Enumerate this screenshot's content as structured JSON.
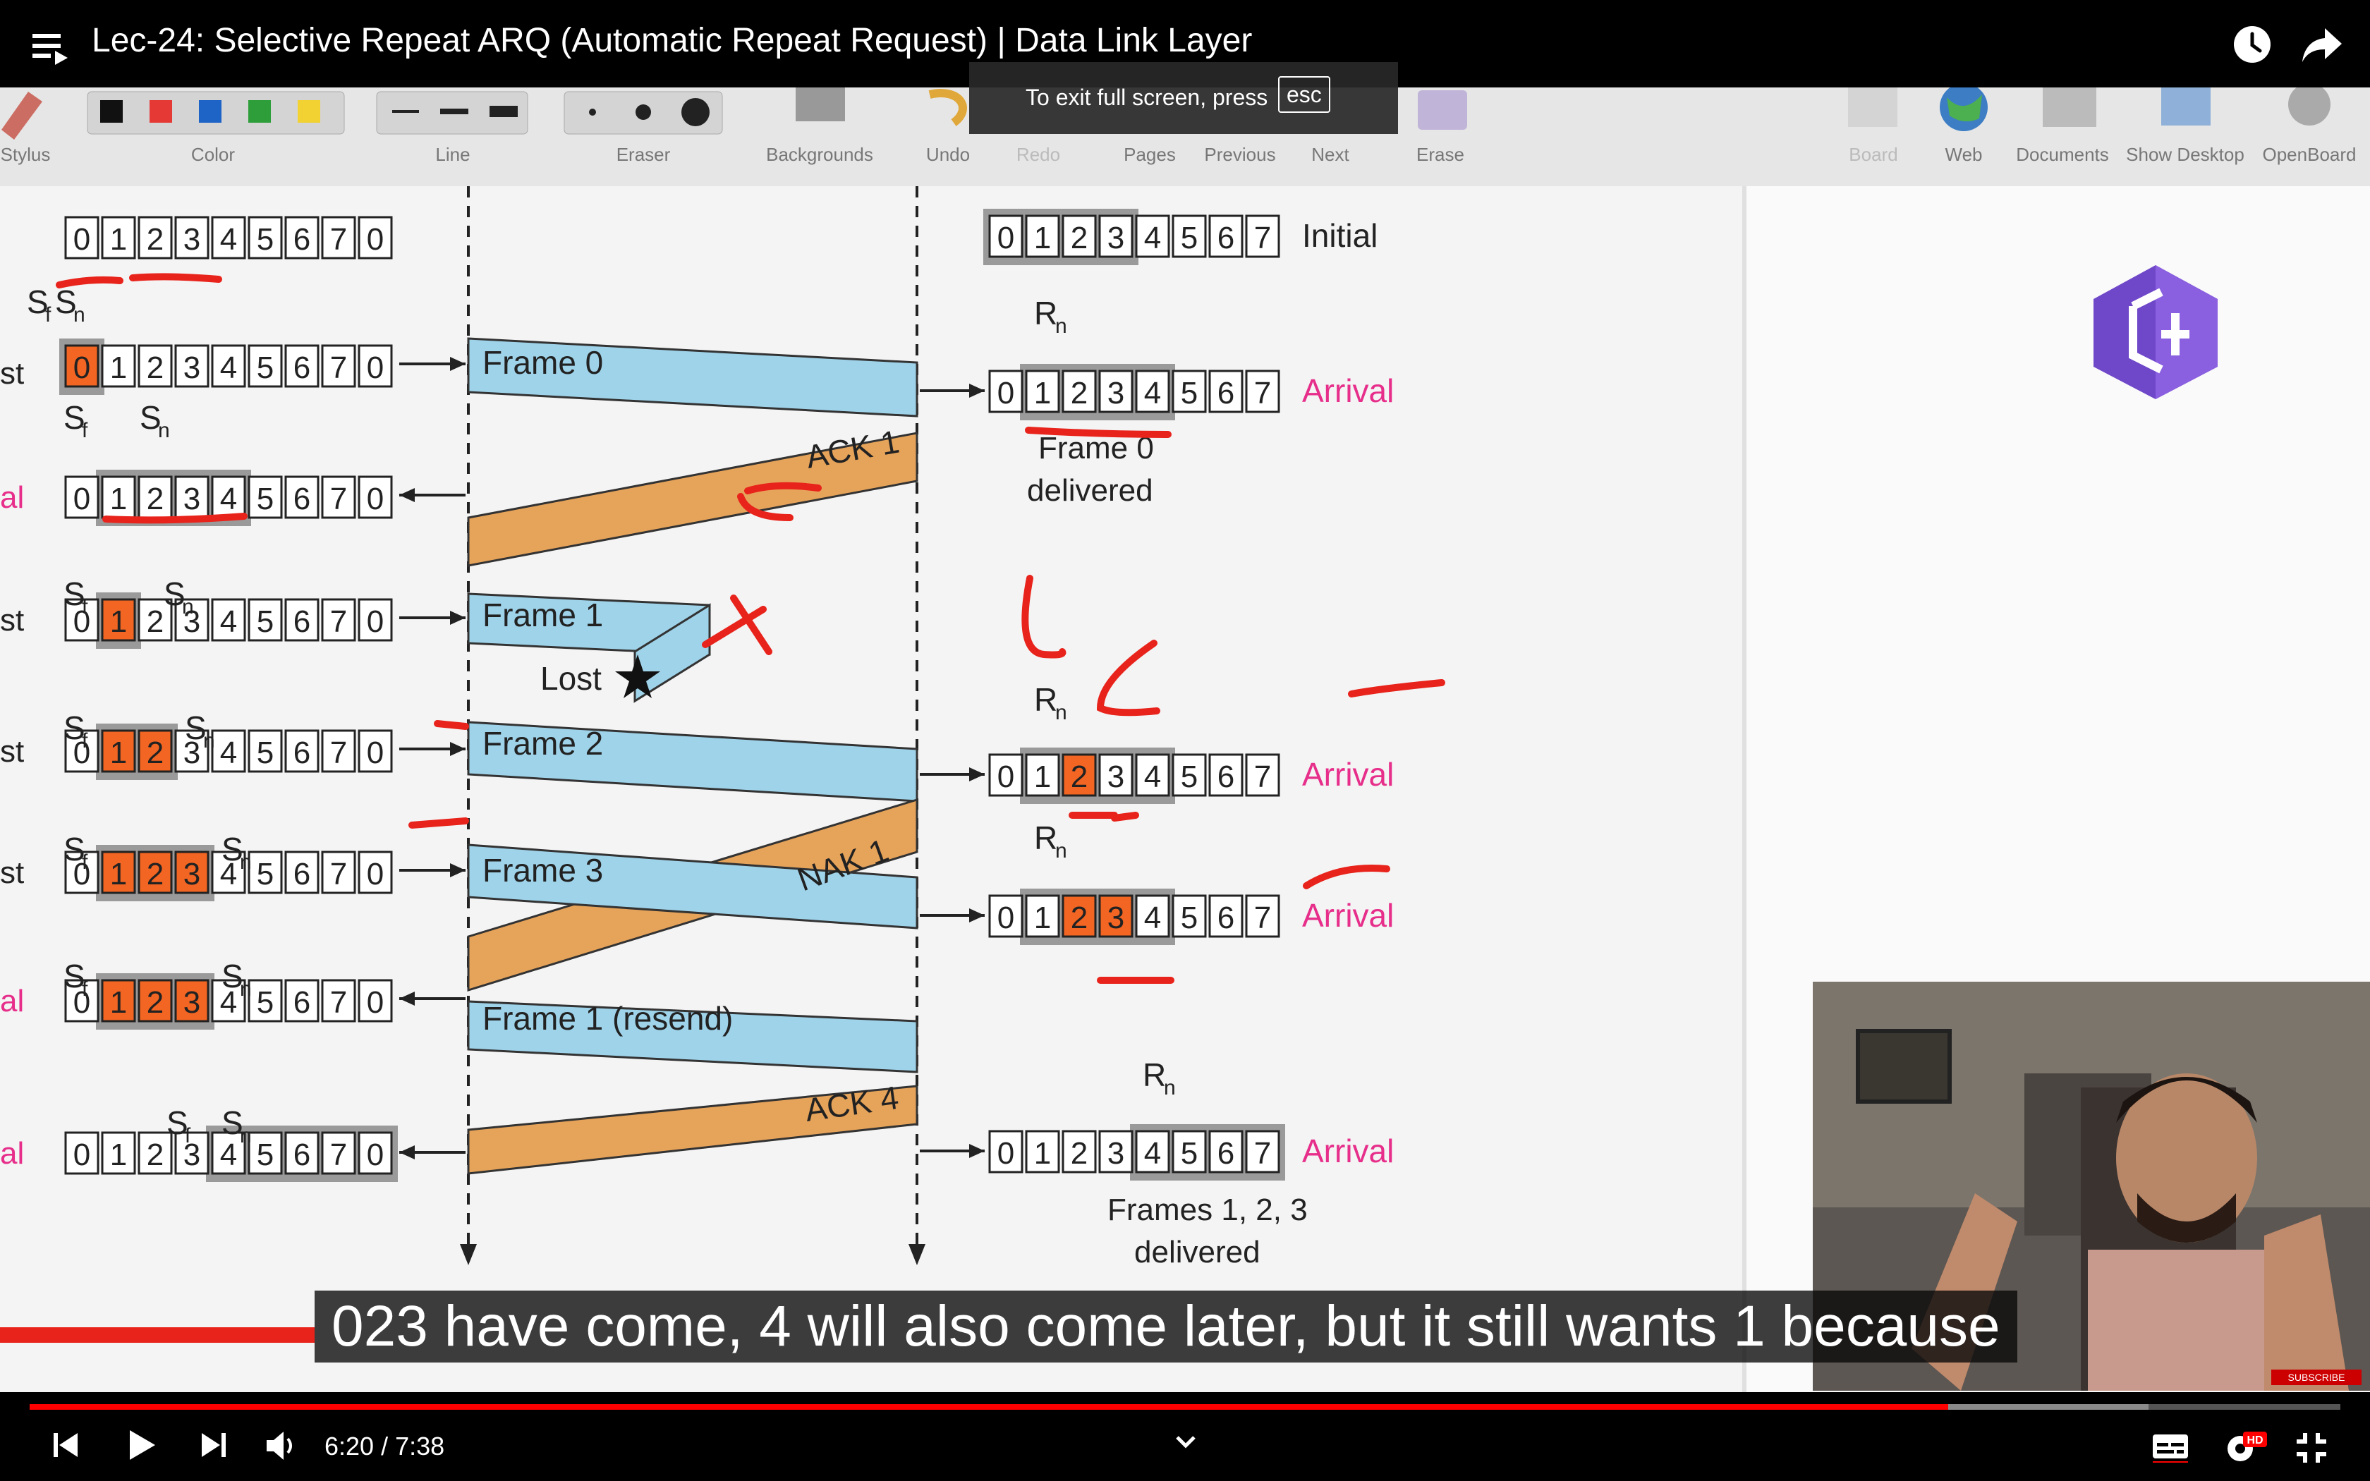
{
  "header": {
    "title": "Lec-24: Selective Repeat ARQ (Automatic Repeat Request) | Data Link Layer"
  },
  "fullscreen_notice": {
    "text": "To exit full screen, press",
    "key": "esc"
  },
  "toolbar": {
    "items": [
      "Stylus",
      "Color",
      "Line",
      "Eraser",
      "Backgrounds",
      "Undo",
      "Redo",
      "Pages",
      "Previous",
      "Next",
      "Erase",
      "Board",
      "Web",
      "Documents",
      "Show Desktop",
      "OpenBoard"
    ]
  },
  "diagram": {
    "digits10": [
      "0",
      "1",
      "2",
      "3",
      "4",
      "5",
      "6",
      "7",
      "0"
    ],
    "digits8": [
      "0",
      "1",
      "2",
      "3",
      "4",
      "5",
      "6",
      "7"
    ],
    "sf": "S",
    "sf_sub": "f",
    "sn": "S",
    "sn_sub": "n",
    "rn": "R",
    "rn_sub": "n",
    "left_labels": [
      "st",
      "al",
      "st",
      "st",
      "st",
      "al",
      "al"
    ],
    "frames": {
      "f0": "Frame 0",
      "f1": "Frame 1",
      "f2": "Frame 2",
      "f3": "Frame 3",
      "f1r": "Frame 1 (resend)",
      "ack1": "ACK 1",
      "nak1": "NAK 1",
      "ack4": "ACK 4",
      "lost": "Lost"
    },
    "right_labels": {
      "initial": "Initial",
      "arrival": "Arrival",
      "frame0_delivered_1": "Frame 0",
      "frame0_delivered_2": "delivered",
      "frames123_1": "Frames 1, 2, 3",
      "frames123_2": "delivered"
    }
  },
  "subtitle": "023 have come, 4 will also come later, but it still wants 1 because",
  "player": {
    "time": "6:20 / 7:38",
    "progress_fraction": 0.83,
    "buffered_fraction": 0.917,
    "hd_badge": "HD",
    "subscribe": "SUBSCRIBE"
  },
  "colors": {
    "accent": "#ff0000",
    "frame_blue": "#9fd3ea",
    "ack_orange": "#e6a35a",
    "cell_orange": "#f26522",
    "arrival_pink": "#e62e8a"
  }
}
